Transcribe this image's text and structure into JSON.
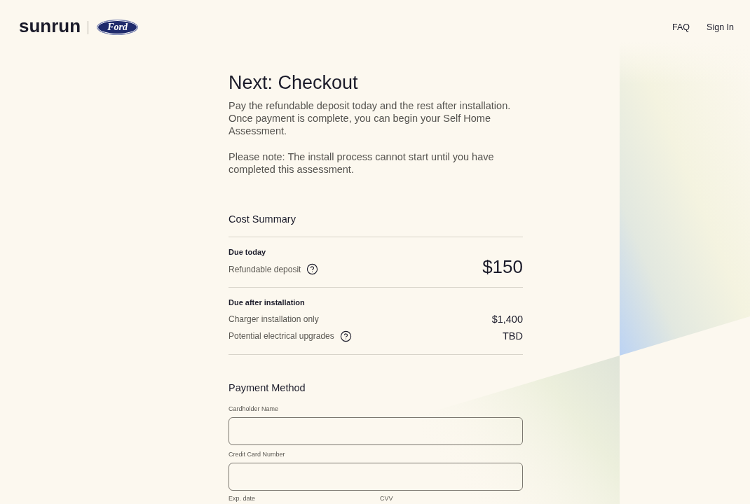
{
  "header": {
    "logo": "sunrun",
    "partner_logo": "Ford",
    "nav": [
      "FAQ",
      "Sign In"
    ]
  },
  "title": "Next: Checkout",
  "intro": [
    "Pay the refundable deposit today and the rest after installation. Once payment is complete, you can begin your Self Home Assessment.",
    "Please note: The install process cannot start until you have completed this assessment."
  ],
  "cost_summary": {
    "heading": "Cost Summary",
    "sections": [
      {
        "kind": "featured",
        "heading": "Due today",
        "rows": [
          {
            "label": "Refundable deposit",
            "info": true,
            "amount": "$150"
          }
        ]
      },
      {
        "kind": "list",
        "heading": "Due after installation",
        "rows": [
          {
            "label": "Charger installation only",
            "info": false,
            "amount": "$1,400"
          },
          {
            "label": "Potential electrical upgrades",
            "info": true,
            "amount": "TBD"
          }
        ]
      }
    ]
  },
  "payment_method": {
    "heading": "Payment Method",
    "fields": [
      {
        "kind": "full",
        "label": "Cardholder Name"
      },
      {
        "kind": "full",
        "label": "Credit Card Number"
      },
      {
        "kind": "half",
        "label": "Exp. date"
      },
      {
        "kind": "half",
        "label": "CVV"
      }
    ]
  }
}
